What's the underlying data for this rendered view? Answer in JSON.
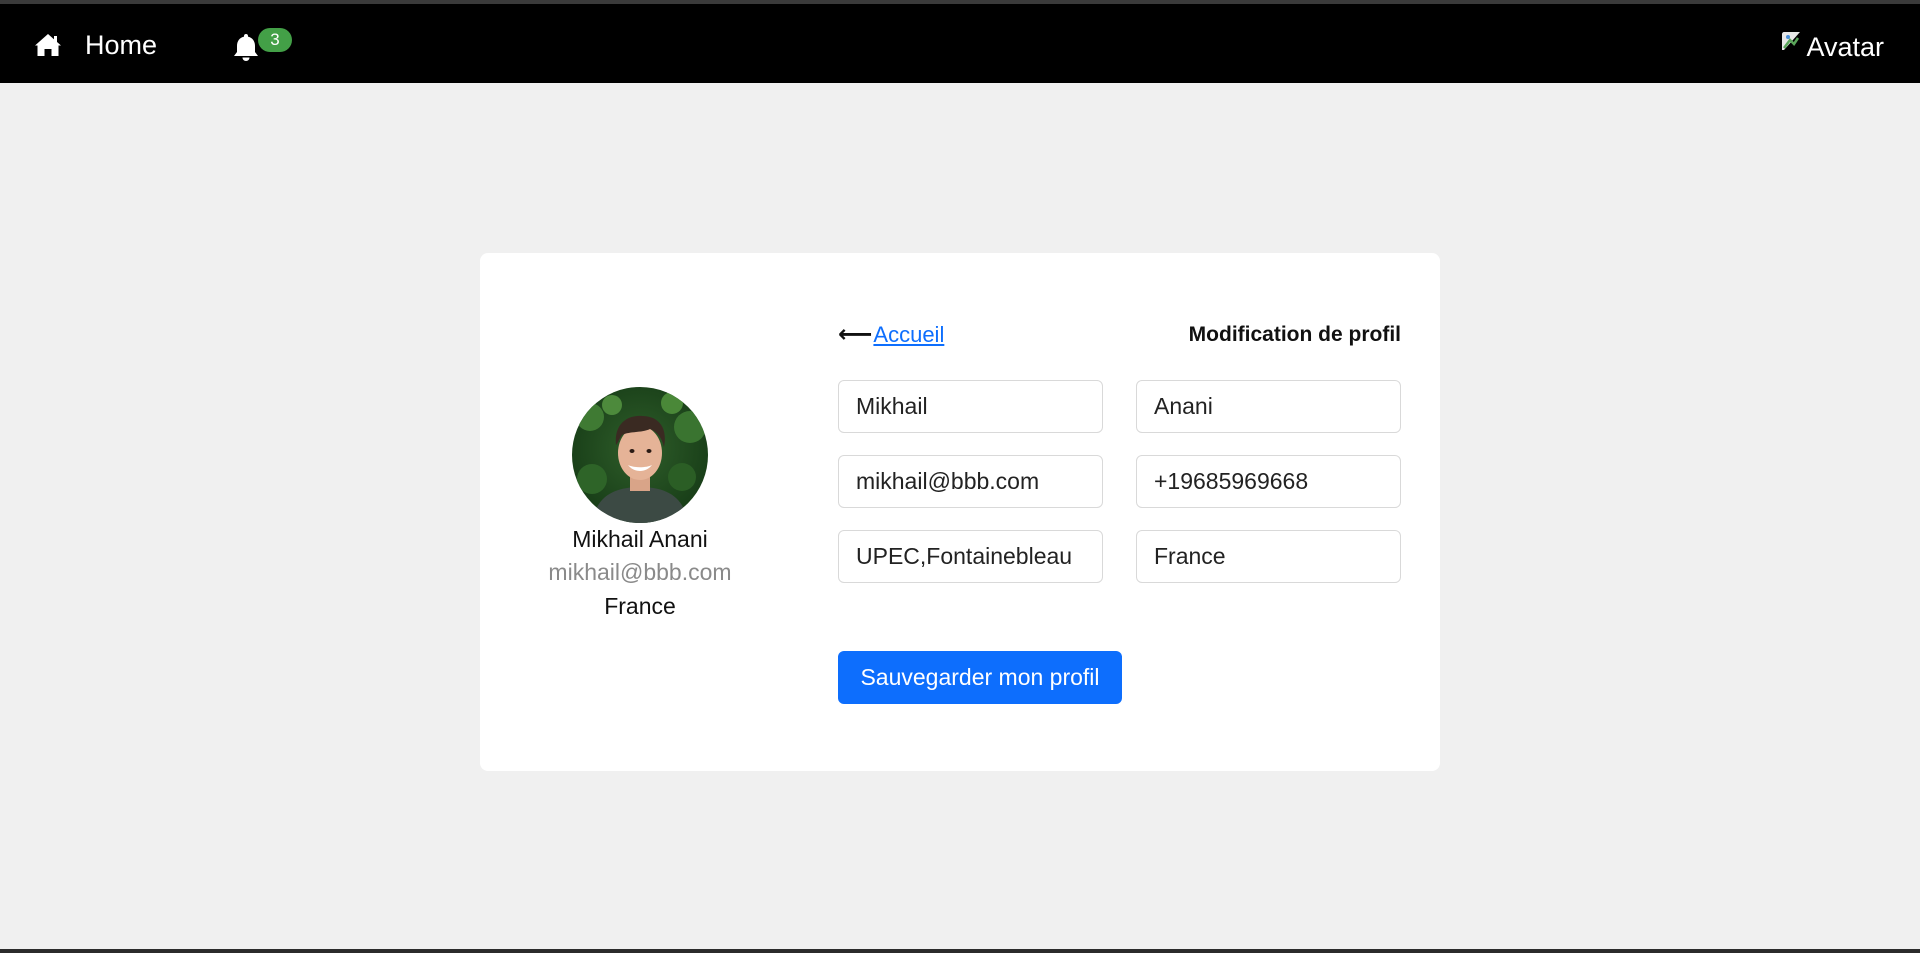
{
  "navbar": {
    "home_label": "Home",
    "notification_count": "3",
    "avatar_alt": "Avatar"
  },
  "profile": {
    "name": "Mikhail Anani",
    "email": "mikhail@bbb.com",
    "country": "France"
  },
  "form": {
    "back_arrow": "⟵",
    "back_label": "Accueil",
    "title": "Modification de profil",
    "first_name": "Mikhail",
    "last_name": "Anani",
    "email": "mikhail@bbb.com",
    "phone": "+19685969668",
    "address": "UPEC,Fontainebleau",
    "country": "France",
    "save_label": "Sauvegarder mon profil"
  },
  "colors": {
    "navbar_bg": "#000000",
    "badge": "#43a047",
    "primary": "#0d6efd",
    "page_bg": "#f0f0f0"
  },
  "icons": {
    "home": "home-icon",
    "bell": "bell-icon",
    "broken_image": "broken-image-icon"
  }
}
